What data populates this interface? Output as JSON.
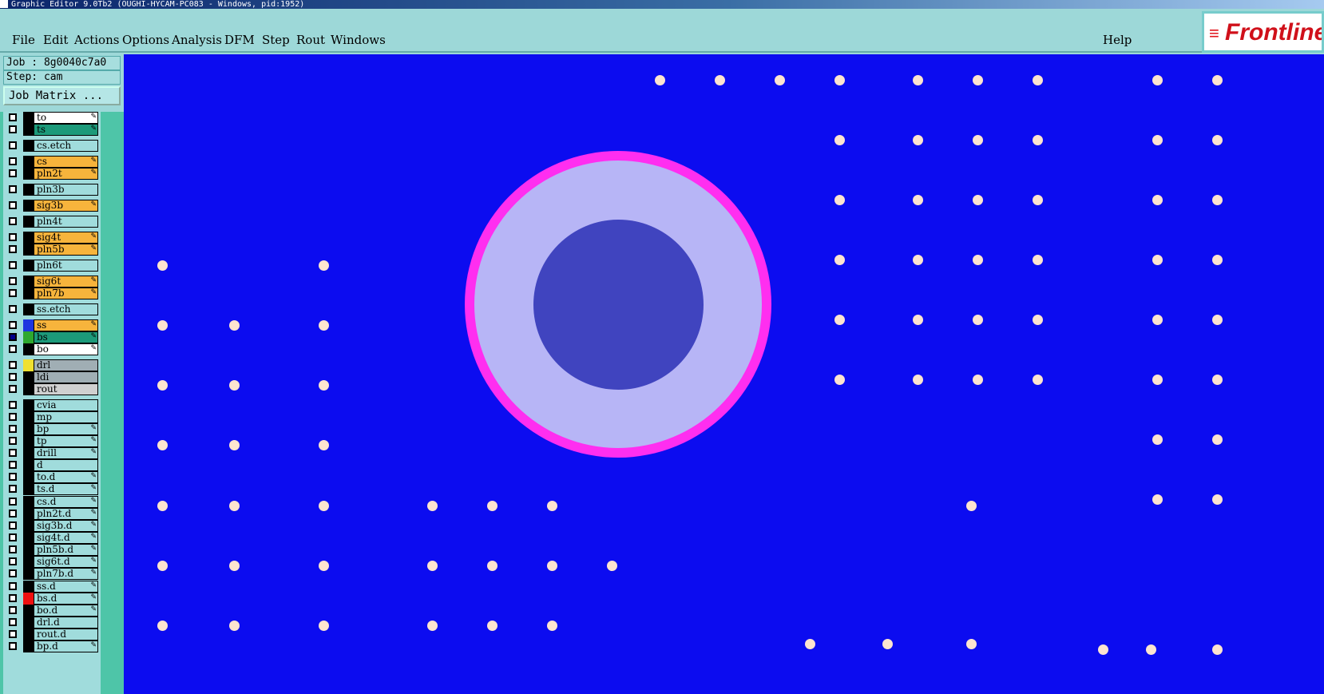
{
  "window": {
    "title": "Graphic Editor 9.0Tb2 (OUGHI-HYCAM-PC083 - Windows, pid:1952)"
  },
  "menubar": {
    "items": [
      "File",
      "Edit",
      "Actions",
      "Options",
      "Analysis",
      "DFM",
      "Step",
      "Rout",
      "Windows"
    ],
    "help": "Help"
  },
  "logo": {
    "text": "Frontline",
    "icon": "frontline-logo"
  },
  "job": {
    "label": "Job : 8g0040c7a0"
  },
  "step": {
    "label": "Step: cam"
  },
  "job_matrix": {
    "label": "Job Matrix ..."
  },
  "colors": {
    "canvas_bg": "#0c0cf0",
    "pad": "#fde4d0",
    "ring_outer": "#ff2ef0",
    "ring_fill": "#b7b5f6",
    "ring_core": "#4044bf",
    "layer_board": "#a0dcdc",
    "layer_signal": "#f7b43c",
    "layer_mask": "#1c9a7a",
    "layer_silk": "#ffffff",
    "layer_drill": "#a0aeb4",
    "layer_rout": "#d0d0d0"
  },
  "layers": [
    {
      "name": "to",
      "color": "#ffffff",
      "icon": "edit-icon"
    },
    {
      "name": "ts",
      "color": "#1c9a7a",
      "icon": "edit-icon"
    },
    {
      "name": "cs.etch",
      "color": "#a0dcdc",
      "icon": ""
    },
    {
      "name": "cs",
      "color": "#f7b43c",
      "icon": "edit-icon"
    },
    {
      "name": "pln2t",
      "color": "#f7b43c",
      "icon": "edit-icon"
    },
    {
      "name": "pln3b",
      "color": "#a0dcdc",
      "icon": ""
    },
    {
      "name": "sig3b",
      "color": "#f7b43c",
      "icon": "edit-icon"
    },
    {
      "name": "pln4t",
      "color": "#a0dcdc",
      "icon": ""
    },
    {
      "name": "sig4t",
      "color": "#f7b43c",
      "icon": "edit-icon"
    },
    {
      "name": "pln5b",
      "color": "#f7b43c",
      "icon": "edit-icon"
    },
    {
      "name": "pln6t",
      "color": "#a0dcdc",
      "icon": ""
    },
    {
      "name": "sig6t",
      "color": "#f7b43c",
      "icon": "edit-icon"
    },
    {
      "name": "pln7b",
      "color": "#f7b43c",
      "icon": "edit-icon"
    },
    {
      "name": "ss.etch",
      "color": "#a0dcdc",
      "icon": ""
    },
    {
      "name": "ss",
      "color": "#f7b43c",
      "icon": "edit-icon",
      "swatch": "#1f35e0"
    },
    {
      "name": "bs",
      "color": "#1c9a7a",
      "icon": "edit-icon",
      "swatch": "#2ea82e",
      "active": true
    },
    {
      "name": "bo",
      "color": "#ffffff",
      "icon": "edit-icon"
    },
    {
      "name": "drl",
      "color": "#a0aeb4",
      "icon": "",
      "swatch": "#f0e030"
    },
    {
      "name": "ldi",
      "color": "#a0aeb4",
      "icon": ""
    },
    {
      "name": "rout",
      "color": "#d0d0d0",
      "icon": ""
    },
    {
      "name": "cvia",
      "color": "#a0dcdc",
      "icon": ""
    },
    {
      "name": "mp",
      "color": "#a0dcdc",
      "icon": ""
    },
    {
      "name": "bp",
      "color": "#a0dcdc",
      "icon": "edit-icon"
    },
    {
      "name": "tp",
      "color": "#a0dcdc",
      "icon": "edit-icon"
    },
    {
      "name": "drill",
      "color": "#a0dcdc",
      "icon": "edit-icon"
    },
    {
      "name": "d",
      "color": "#a0dcdc",
      "icon": ""
    },
    {
      "name": "to.d",
      "color": "#a0dcdc",
      "icon": "edit-icon"
    },
    {
      "name": "ts.d",
      "color": "#a0dcdc",
      "icon": "edit-icon"
    },
    {
      "name": "cs.d",
      "color": "#a0dcdc",
      "icon": "edit-icon"
    },
    {
      "name": "pln2t.d",
      "color": "#a0dcdc",
      "icon": "edit-icon"
    },
    {
      "name": "sig3b.d",
      "color": "#a0dcdc",
      "icon": "edit-icon"
    },
    {
      "name": "sig4t.d",
      "color": "#a0dcdc",
      "icon": "edit-icon"
    },
    {
      "name": "pln5b.d",
      "color": "#a0dcdc",
      "icon": "edit-icon"
    },
    {
      "name": "sig6t.d",
      "color": "#a0dcdc",
      "icon": "edit-icon"
    },
    {
      "name": "pln7b.d",
      "color": "#a0dcdc",
      "icon": "edit-icon"
    },
    {
      "name": "ss.d",
      "color": "#a0dcdc",
      "icon": "edit-icon"
    },
    {
      "name": "bs.d",
      "color": "#a0dcdc",
      "icon": "edit-icon",
      "swatch": "#f01010"
    },
    {
      "name": "bo.d",
      "color": "#a0dcdc",
      "icon": "edit-icon"
    },
    {
      "name": "drl.d",
      "color": "#a0dcdc",
      "icon": ""
    },
    {
      "name": "rout.d",
      "color": "#a0dcdc",
      "icon": ""
    },
    {
      "name": "bp.d",
      "color": "#a0dcdc",
      "icon": "edit-icon"
    }
  ]
}
